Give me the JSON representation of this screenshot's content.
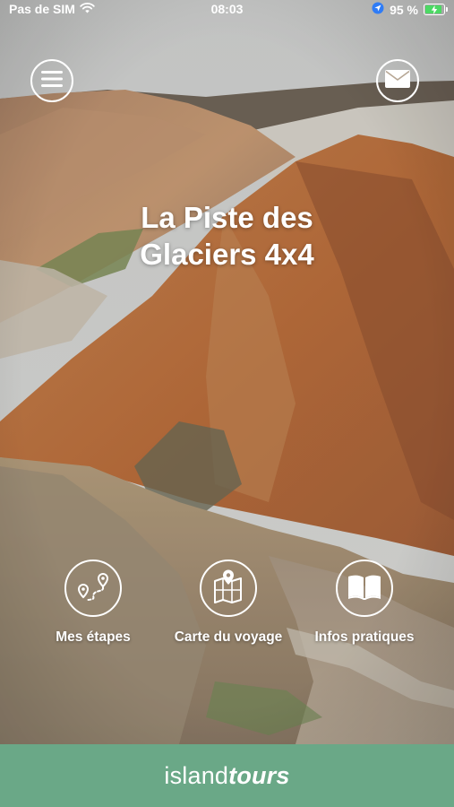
{
  "status_bar": {
    "carrier": "Pas de SIM",
    "time": "08:03",
    "battery_percent": "95 %",
    "battery_level": 0.95,
    "icons": [
      "wifi-icon",
      "location-icon",
      "battery-icon"
    ]
  },
  "header": {
    "menu_icon": "hamburger-menu-icon",
    "mail_icon": "envelope-icon"
  },
  "hero": {
    "title_line1": "La Piste des",
    "title_line2": "Glaciers 4x4"
  },
  "actions": [
    {
      "label": "Mes étapes",
      "icon": "route-pins-icon"
    },
    {
      "label": "Carte du voyage",
      "icon": "map-pin-icon"
    },
    {
      "label": "Infos pratiques",
      "icon": "open-book-icon"
    }
  ],
  "footer": {
    "brand_part1": "island",
    "brand_part2": "tours"
  },
  "colors": {
    "footer_bg": "#6aa887",
    "battery_charge": "#4cd964"
  }
}
